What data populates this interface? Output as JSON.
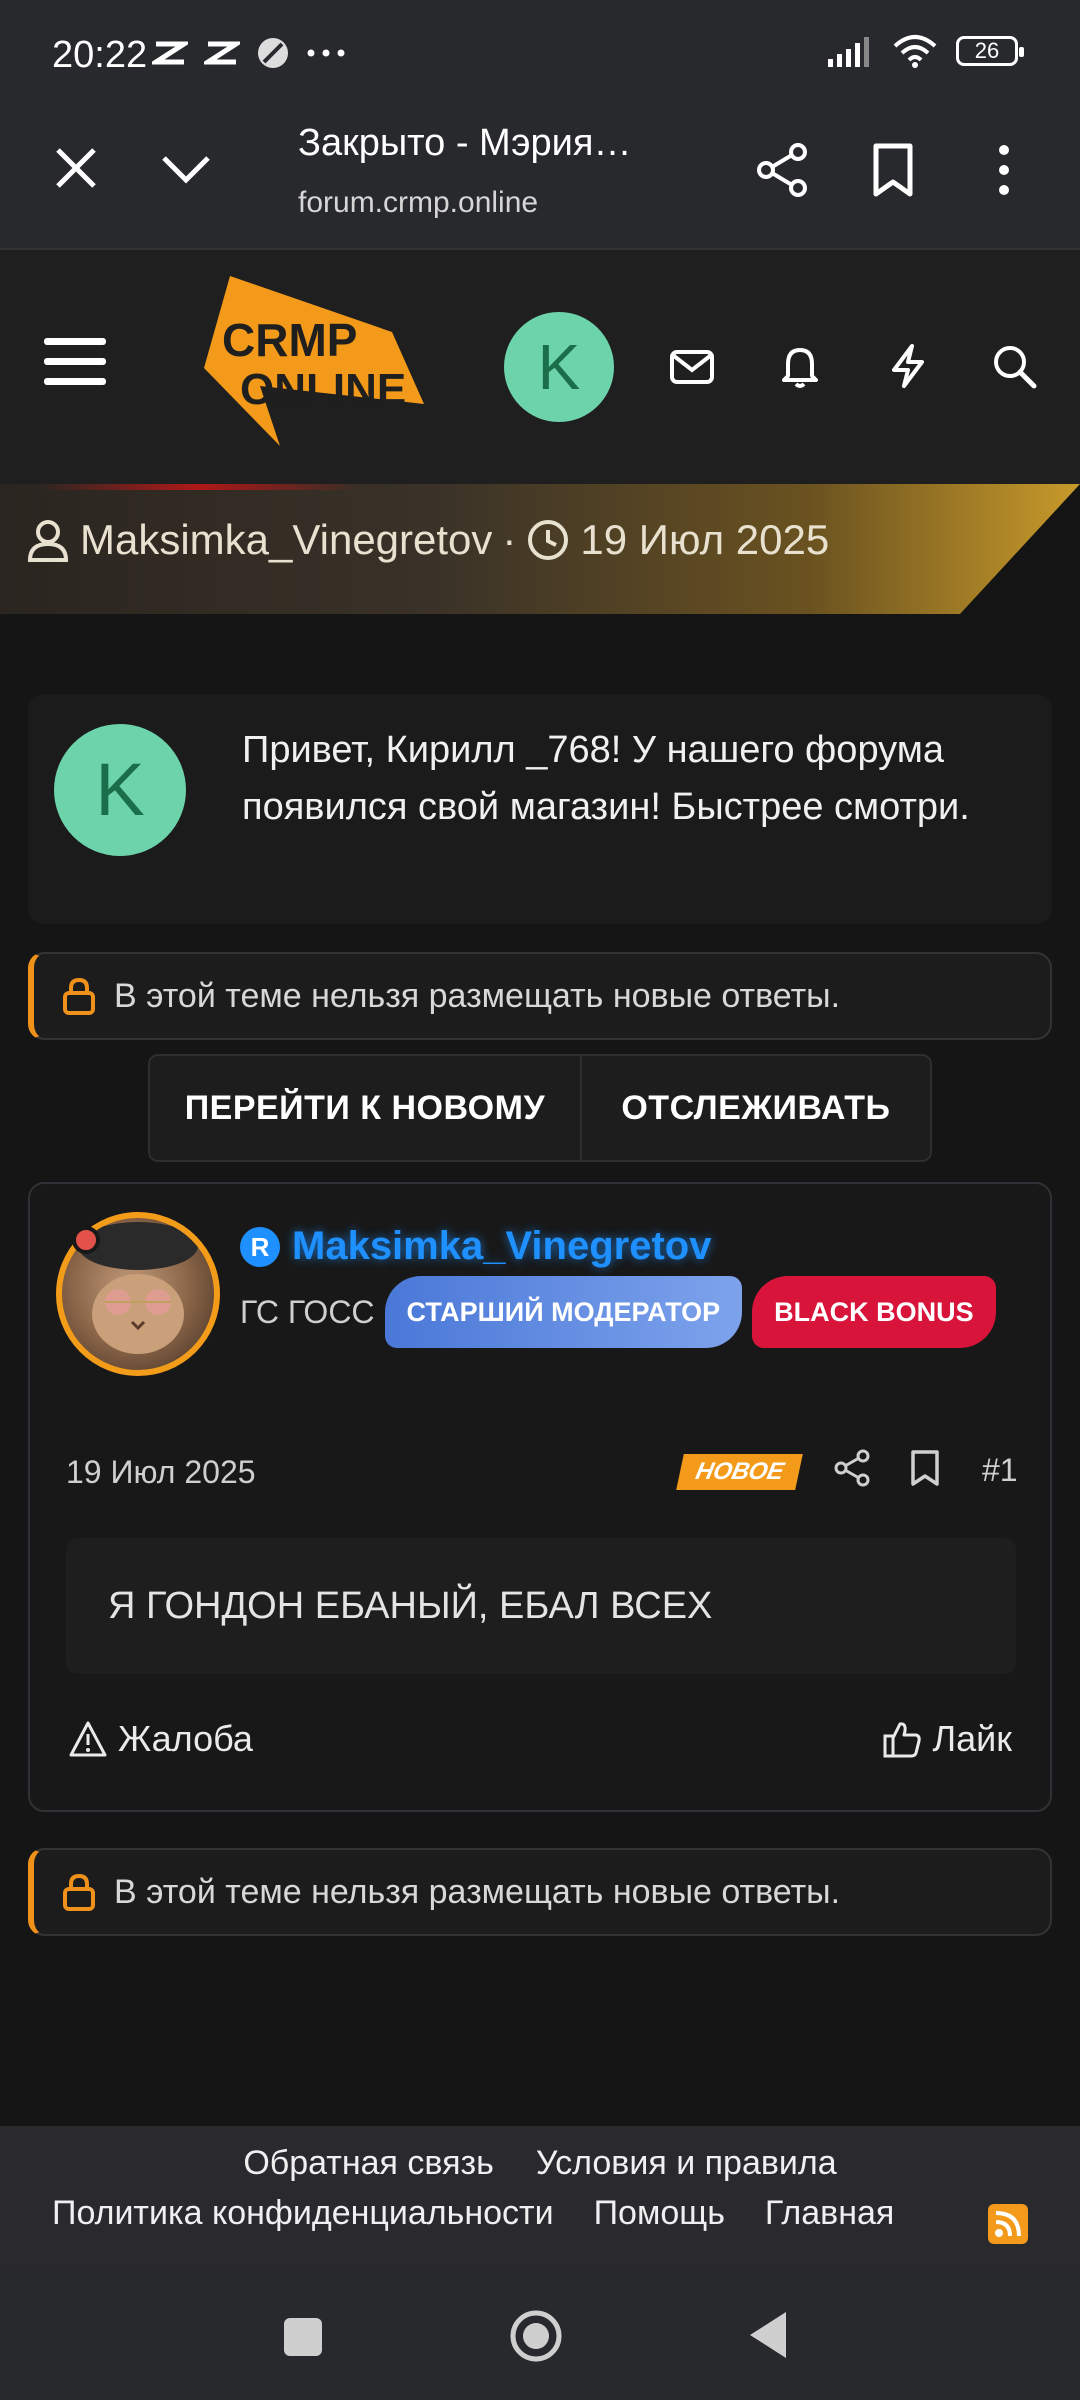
{
  "status_bar": {
    "time": "20:22",
    "battery": "26",
    "icons": [
      "capcut-icon",
      "capcut-icon",
      "browser-app-icon",
      "more-dots-icon",
      "signal-icon",
      "wifi-icon",
      "battery-icon"
    ]
  },
  "browser": {
    "title": "Закрыто - Мэрия…",
    "url": "forum.crmp.online",
    "icons": [
      "close-icon",
      "chevron-down-icon",
      "share-icon",
      "bookmark-icon",
      "more-vertical-icon"
    ]
  },
  "header": {
    "logo_text_line1": "CRMP",
    "logo_text_line2": "ONLINE",
    "avatar_letter": "K",
    "icons": [
      "menu-icon",
      "mail-icon",
      "bell-icon",
      "lightning-icon",
      "search-icon"
    ]
  },
  "thread_banner": {
    "author": "Maksimka_Vinegretov",
    "separator": "·",
    "date": "19 Июл 2025"
  },
  "greeting": {
    "avatar_letter": "K",
    "text": "Привет, Кирилл _768! У нашего форума появился свой магазин! Быстрее смотри."
  },
  "locked_notice": {
    "text": "В этой теме нельзя размещать новые ответы."
  },
  "actions": {
    "go_to_new": "ПЕРЕЙТИ К НОВОМУ",
    "watch": "ОТСЛЕЖИВАТЬ"
  },
  "post": {
    "username_badge": "R",
    "username": "Maksimka_Vinegretov",
    "role_text": "ГС ГОСС",
    "badges": [
      "СТАРШИЙ МОДЕРАТОР",
      "BLACK BONUS"
    ],
    "date": "19 Июл 2025",
    "new_label": "НОВОЕ",
    "post_number": "#1",
    "body": "Я ГОНДОН ЕБАНЫЙ, ЕБАЛ ВСЕХ",
    "report_label": "Жалоба",
    "like_label": "Лайк"
  },
  "footer": {
    "links_row1": [
      "Обратная связь",
      "Условия и правила"
    ],
    "links_row2": [
      "Политика конфиденциальности",
      "Помощь",
      "Главная"
    ]
  },
  "colors": {
    "accent_orange": "#f39a1a",
    "username_blue": "#1e90ff",
    "avatar_green": "#6dd3ab",
    "badge_red": "#d8143a"
  }
}
